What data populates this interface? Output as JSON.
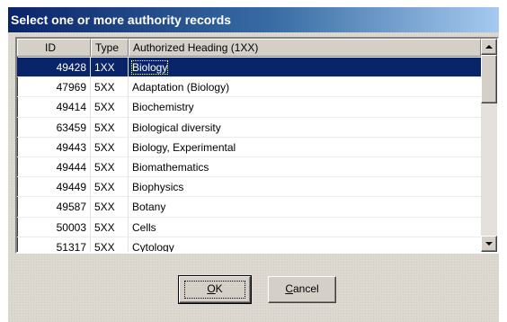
{
  "dialog": {
    "title": "Select one or more authority records"
  },
  "list": {
    "columns": {
      "id": "ID",
      "type": "Type",
      "heading": "Authorized Heading (1XX)"
    },
    "rows": [
      {
        "id": "49428",
        "type": "1XX",
        "heading": "Biology",
        "selected": true
      },
      {
        "id": "47969",
        "type": "5XX",
        "heading": "Adaptation (Biology)"
      },
      {
        "id": "49414",
        "type": "5XX",
        "heading": "Biochemistry"
      },
      {
        "id": "63459",
        "type": "5XX",
        "heading": "Biological diversity"
      },
      {
        "id": "49443",
        "type": "5XX",
        "heading": "Biology, Experimental"
      },
      {
        "id": "49444",
        "type": "5XX",
        "heading": "Biomathematics"
      },
      {
        "id": "49449",
        "type": "5XX",
        "heading": "Biophysics"
      },
      {
        "id": "49587",
        "type": "5XX",
        "heading": "Botany"
      },
      {
        "id": "50003",
        "type": "5XX",
        "heading": "Cells"
      },
      {
        "id": "51317",
        "type": "5XX",
        "heading": "Cytology"
      }
    ]
  },
  "buttons": {
    "ok_mnemonic": "O",
    "ok_rest": "K",
    "cancel_mnemonic": "C",
    "cancel_rest": "ancel"
  },
  "colors": {
    "selection": "#0a246a",
    "title_start": "#0a246a",
    "title_end": "#a6caf0"
  }
}
